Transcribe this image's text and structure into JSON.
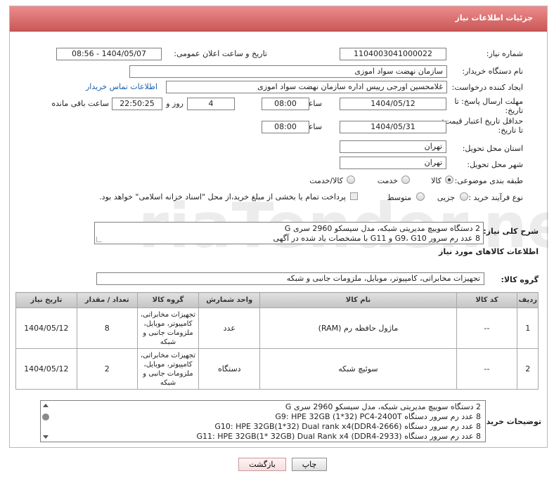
{
  "header": {
    "title": "جزئیات اطلاعات نیاز"
  },
  "need_number": {
    "label": "شماره نیاز:",
    "value": "1104003041000022"
  },
  "announce_datetime": {
    "label": "تاریخ و ساعت اعلان عمومی:",
    "value": "1404/05/07 - 08:56"
  },
  "buyer_org": {
    "label": "نام دستگاه خریدار:",
    "value": "سازمان نهضت سواد اموزی"
  },
  "requester": {
    "label": "ایجاد کننده درخواست:",
    "value": "غلامحسین اورجی رییس اداره سازمان نهضت سواد اموزی",
    "contact_link": "اطلاعات تماس خریدار"
  },
  "reply_deadline": {
    "label_line1": "مهلت ارسال پاسخ: تا",
    "label_line2": "تاریخ:",
    "date": "1404/05/12",
    "time_label": "ساعت",
    "time": "08:00",
    "days": "4",
    "days_label": "روز و",
    "remaining": "22:50:25",
    "remaining_label": "ساعت باقی مانده"
  },
  "price_validity": {
    "label_line1": "حداقل تاریخ اعتبار قیمت:",
    "label_line2": "تا تاریخ:",
    "date": "1404/05/31",
    "time_label": "ساعت",
    "time": "08:00"
  },
  "delivery_province": {
    "label": "استان محل تحویل:",
    "value": "تهران"
  },
  "delivery_city": {
    "label": "شهر محل تحویل:",
    "value": "تهران"
  },
  "category": {
    "label": "طبقه بندی موضوعی:",
    "options": [
      "کالا",
      "خدمت",
      "کالا/خدمت"
    ],
    "selected": "کالا"
  },
  "purchase_process": {
    "label": "نوع فرآیند خرید :",
    "options": [
      "جزیی",
      "متوسط"
    ],
    "payment_note": "پرداخت تمام یا بخشی از مبلغ خرید،از محل \"اسناد خزانه اسلامی\" خواهد بود."
  },
  "overall_desc": {
    "label": "شرح کلی نیاز:",
    "lines": [
      "2 دستگاه سوییچ مدیریتی شبکه، مدل سیسکو 2960 سری G",
      "8 عدد رم سرور G9، G10 و G11 با مشخصات یاد شده در آگهی"
    ]
  },
  "goods_info": {
    "title": "اطلاعات کالاهای مورد نیاز"
  },
  "goods_group": {
    "label": "گروه کالا:",
    "value": "تجهیزات مخابراتی، کامپیوتر، موبایل، ملزومات جانبی و شبکه"
  },
  "table": {
    "headers": [
      "ردیف",
      "کد کالا",
      "نام کالا",
      "واحد شمارش",
      "گروه کالا",
      "تعداد / مقدار",
      "تاریخ نیاز"
    ],
    "rows": [
      {
        "row": "1",
        "code": "--",
        "name": "ماژول حافظه رم (RAM)",
        "unit": "عدد",
        "group": "تجهیزات مخابراتی، کامپیوتر، موبایل، ملزومات جانبی و شبکه",
        "qty": "8",
        "date": "1404/05/12"
      },
      {
        "row": "2",
        "code": "--",
        "name": "سوئیچ شبکه",
        "unit": "دستگاه",
        "group": "تجهیزات مخابراتی، کامپیوتر، موبایل، ملزومات جانبی و شبکه",
        "qty": "2",
        "date": "1404/05/12"
      }
    ]
  },
  "buyer_notes": {
    "label": "توضیحات خریدار:",
    "lines": [
      "2 دستگاه سوییچ مدیریتی شبکه، مدل سیسکو 2960 سری G",
      "8 عدد رم سرور دستگاه G9:  HPE 32GB (1*32) PC4-2400T",
      "8 عدد رم سرور دستگاه G10:  HPE 32GB(1*32) Dual rank x4(DDR4-2666)",
      "8 عدد رم سرور دستگاه  G11:  HPE 32GB(1* 32GB) Dual Rank x4 (DDR4-2933)"
    ]
  },
  "buttons": {
    "print": "چاپ",
    "back": "بازگشت"
  },
  "watermark_text": "AriaTender.net"
}
